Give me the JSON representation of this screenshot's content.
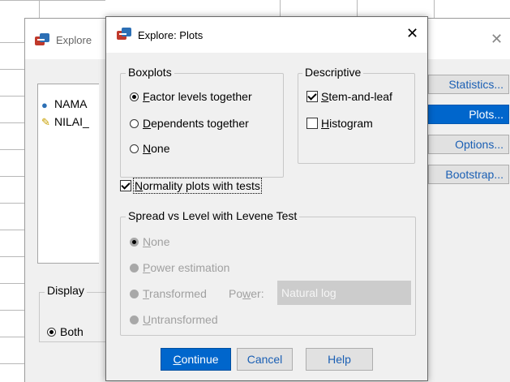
{
  "background_window": {
    "title": "Explore",
    "close_glyph": "✕",
    "variables": [
      {
        "name": "NAMA",
        "icon": "nominal-variable-icon"
      },
      {
        "name": "NILAI_",
        "icon": "scale-variable-icon"
      }
    ],
    "side_buttons": [
      "Statistics...",
      "Plots...",
      "Options...",
      "Bootstrap..."
    ],
    "display": {
      "label": "Display",
      "selected": "Both"
    }
  },
  "dialog": {
    "title": "Explore: Plots",
    "close_glyph": "✕",
    "boxplots": {
      "label": "Boxplots",
      "options": [
        {
          "pre": "",
          "key": "F",
          "post": "actor levels together",
          "selected": true
        },
        {
          "pre": "",
          "key": "D",
          "post": "ependents together",
          "selected": false
        },
        {
          "pre": "",
          "key": "N",
          "post": "one",
          "selected": false
        }
      ]
    },
    "descriptive": {
      "label": "Descriptive",
      "options": [
        {
          "pre": "",
          "key": "S",
          "post": "tem-and-leaf",
          "checked": true
        },
        {
          "pre": "",
          "key": "H",
          "post": "istogram",
          "checked": false
        }
      ]
    },
    "normality": {
      "pre": "",
      "key": "N",
      "post": "ormality plots with tests",
      "checked": true
    },
    "spread": {
      "label": "Spread vs Level with Levene Test",
      "options": [
        {
          "pre": "",
          "key": "N",
          "post": "one",
          "selected": true
        },
        {
          "pre": "",
          "key": "P",
          "post": "ower estimation",
          "selected": false
        },
        {
          "pre": "",
          "key": "T",
          "post": "ransformed",
          "selected": false
        },
        {
          "pre": "",
          "key": "U",
          "post": "ntransformed",
          "selected": false
        }
      ],
      "power_pre": "Po",
      "power_key": "w",
      "power_post": "er:",
      "power_value": "Natural log"
    },
    "buttons": {
      "continue_key": "C",
      "continue_rest": "ontinue",
      "cancel": "Cancel",
      "help": "Help"
    }
  }
}
